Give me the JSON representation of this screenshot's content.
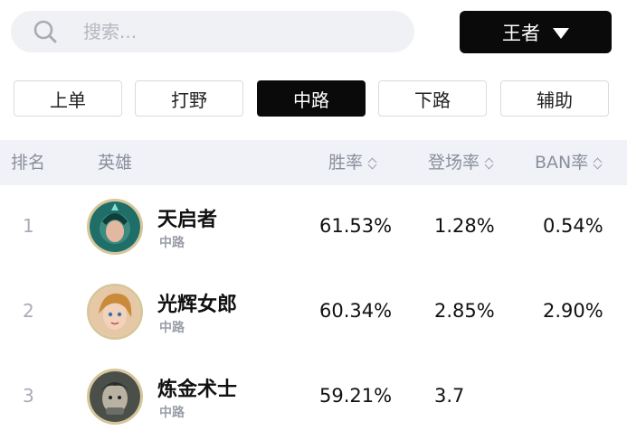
{
  "search": {
    "placeholder": "搜索..."
  },
  "rank_filter": {
    "selected": "王者"
  },
  "tabs": [
    {
      "label": "上单",
      "active": false
    },
    {
      "label": "打野",
      "active": false
    },
    {
      "label": "中路",
      "active": true
    },
    {
      "label": "下路",
      "active": false
    },
    {
      "label": "辅助",
      "active": false
    }
  ],
  "table": {
    "headers": {
      "rank": "排名",
      "hero": "英雄",
      "win_rate": "胜率",
      "pick_rate": "登场率",
      "ban_rate": "BAN率"
    },
    "rows": [
      {
        "rank": "1",
        "name": "天启者",
        "role": "中路",
        "win_rate": "61.53%",
        "pick_rate": "1.28%",
        "ban_rate": "0.54%",
        "avatar": "hero-avatar-tianqizhe"
      },
      {
        "rank": "2",
        "name": "光辉女郎",
        "role": "中路",
        "win_rate": "60.34%",
        "pick_rate": "2.85%",
        "ban_rate": "2.90%",
        "avatar": "hero-avatar-guanghui"
      },
      {
        "rank": "3",
        "name": "炼金术士",
        "role": "中路",
        "win_rate": "59.21%",
        "pick_rate": "3.7",
        "ban_rate": "",
        "avatar": "hero-avatar-lianjin"
      }
    ]
  },
  "colors": {
    "accent": "#0a0a0a",
    "header_bg": "#f0f2f7",
    "search_bg": "#f0f1f5"
  }
}
